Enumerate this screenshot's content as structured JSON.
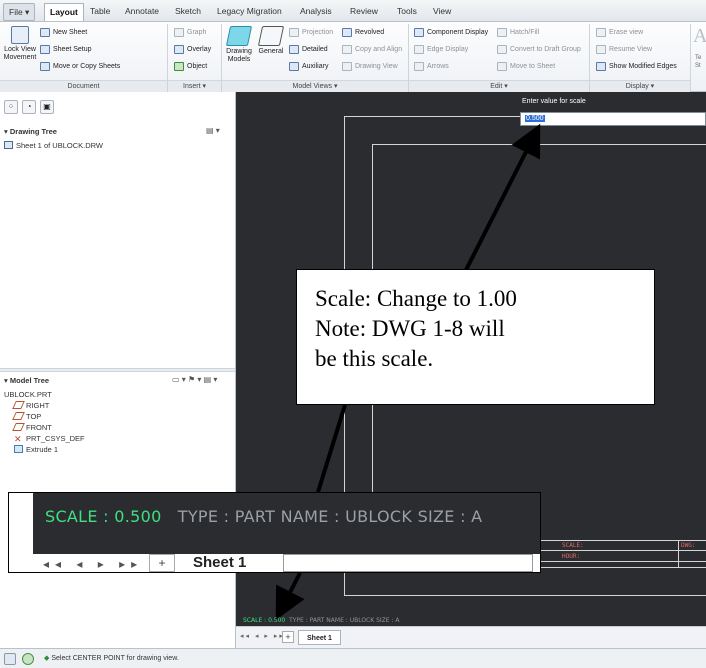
{
  "menu": {
    "tabs": [
      {
        "label": "File ▾"
      },
      {
        "label": "Layout"
      },
      {
        "label": "Table"
      },
      {
        "label": "Annotate"
      },
      {
        "label": "Sketch"
      },
      {
        "label": "Legacy Migration"
      },
      {
        "label": "Analysis"
      },
      {
        "label": "Review"
      },
      {
        "label": "Tools"
      },
      {
        "label": "View"
      }
    ],
    "active": "Layout"
  },
  "ribbon": {
    "document": {
      "lock_view_label": "Lock View Movement",
      "new_sheet": "New Sheet",
      "sheet_setup": "Sheet Setup",
      "move_copy": "Move or Copy Sheets",
      "footer": "Document"
    },
    "insert": {
      "graph": "Graph",
      "overlay": "Overlay",
      "object": "Object",
      "footer": "Insert ▾"
    },
    "model_views": {
      "drawing_models": "Drawing Models",
      "general": "General",
      "projection": "Projection",
      "revolved": "Revolved",
      "detailed": "Detailed",
      "copy_align": "Copy and Align",
      "auxiliary": "Auxiliary",
      "drawing_view": "Drawing View",
      "footer": "Model Views ▾"
    },
    "edit": {
      "component_display": "Component Display",
      "hatch_fill": "Hatch/Fill",
      "edge_display": "Edge Display",
      "convert_draft_group": "Convert to Draft Group",
      "arrows": "Arrows",
      "move_to_sheet": "Move to Sheet",
      "footer": "Edit ▾"
    },
    "display": {
      "erase_view": "Erase view",
      "resume_view": "Resume View",
      "show_modified_edges": "Show Modified Edges",
      "footer": "Display ▾"
    },
    "format_partial": "Te St"
  },
  "left_panel": {
    "drawing_tree_header": "Drawing Tree",
    "drawing_tree_items": [
      "Sheet 1 of UBLOCK.DRW"
    ],
    "model_tree_header": "Model Tree",
    "model_tree_items": [
      {
        "label": "UBLOCK.PRT",
        "icon": "none"
      },
      {
        "label": "RIGHT",
        "icon": "datum-plane-icon"
      },
      {
        "label": "TOP",
        "icon": "datum-plane-icon"
      },
      {
        "label": "FRONT",
        "icon": "datum-plane-icon"
      },
      {
        "label": "PRT_CSYS_DEF",
        "icon": "csys-icon"
      },
      {
        "label": "Extrude 1",
        "icon": "extrude-icon"
      }
    ]
  },
  "prompt": {
    "label": "Enter value for scale",
    "value": "0.500"
  },
  "title_block": {
    "scale_label": "SCALE:",
    "hour_label": "HOUR:",
    "dwg_label": "DWG:"
  },
  "callout": {
    "line1": "Scale: Change to 1.00",
    "line2": "Note: DWG 1-8 will",
    "line3": "be this scale."
  },
  "zoom_inset": {
    "scale_text": "SCALE : 0.500",
    "rest_text": "TYPE : PART    NAME : UBLOCK    SIZE : A",
    "nav": "◂◂ ◂ ▸ ▸▸",
    "plus": "+",
    "sheet": "Sheet 1"
  },
  "status_mini": {
    "scale_text": "SCALE : 0.500",
    "rest_text": "TYPE : PART   NAME : UBLOCK   SIZE : A"
  },
  "sheet_tabs": {
    "nav": "◂◂ ◂ ▸ ▸▸",
    "plus": "+",
    "active": "Sheet 1"
  },
  "statusbar": {
    "message": "Select CENTER POINT for drawing view."
  },
  "colors": {
    "canvas_bg": "#2a2c2f",
    "scale_green": "#3fe080",
    "title_block_red": "#e06b6b",
    "selection_blue": "#2f6fd6"
  }
}
